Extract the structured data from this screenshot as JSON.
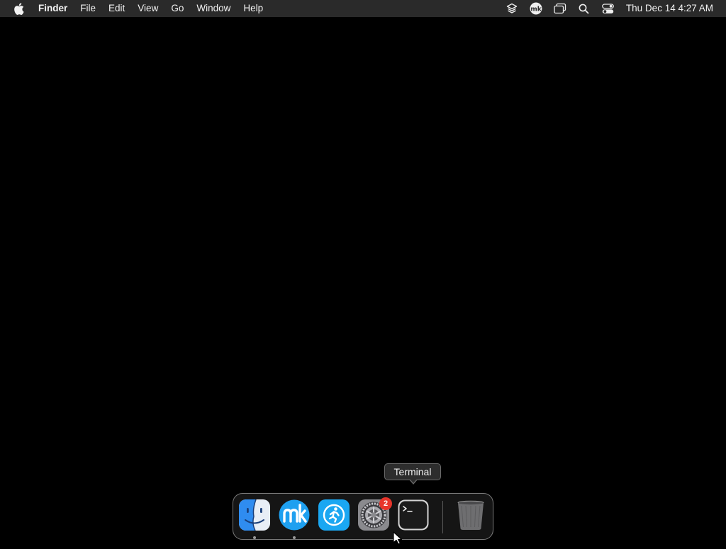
{
  "menubar": {
    "app_name": "Finder",
    "menus": [
      "File",
      "Edit",
      "View",
      "Go",
      "Window",
      "Help"
    ],
    "status_icons": [
      "layers-icon",
      "mk-icon",
      "screen-mirroring-icon",
      "search-icon",
      "control-center-icon"
    ],
    "clock": "Thu Dec 14  4:27 AM"
  },
  "dock": {
    "apps": [
      {
        "name": "finder-icon",
        "running": true
      },
      {
        "name": "mk-app-icon",
        "running": true
      },
      {
        "name": "runner-app-icon",
        "running": false
      },
      {
        "name": "system-settings-icon",
        "running": false,
        "badge": "2"
      },
      {
        "name": "terminal-icon",
        "running": false
      }
    ],
    "trash": "trash-icon"
  },
  "tooltip": {
    "text": "Terminal"
  },
  "colors": {
    "menubar_bg": "#2a2a2a",
    "desktop_bg": "#000000",
    "badge": "#e8352b",
    "mk_blue": "#1ea0f0"
  }
}
